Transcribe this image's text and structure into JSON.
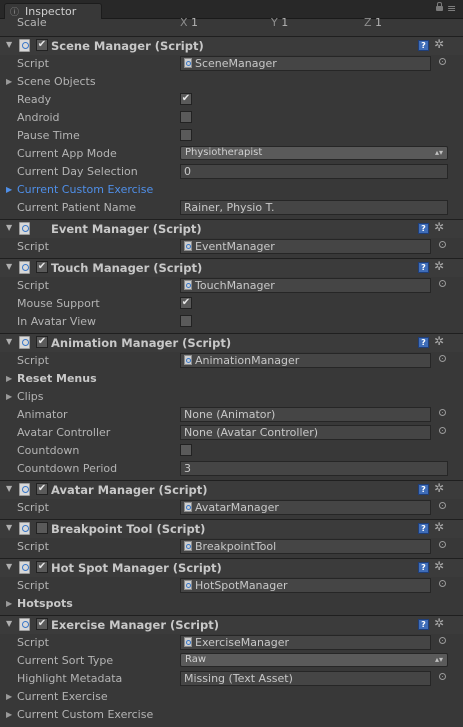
{
  "window": {
    "tab_label": "Inspector"
  },
  "scale": {
    "label": "Scale",
    "x": "1",
    "y": "1",
    "z": "1",
    "x_label": "X",
    "y_label": "Y",
    "z_label": "Z"
  },
  "components": {
    "scene": {
      "title": "Scene Manager (Script)",
      "script_label": "Script",
      "script_value": "SceneManager",
      "scene_objects": "Scene Objects",
      "ready_label": "Ready",
      "ready": true,
      "android_label": "Android",
      "android": false,
      "pause_label": "Pause Time",
      "pause": false,
      "app_mode_label": "Current App Mode",
      "app_mode": "Physiotherapist",
      "day_label": "Current Day Selection",
      "day": "0",
      "custom_ex_label": "Current Custom Exercise",
      "patient_label": "Current Patient Name",
      "patient": "Rainer, Physio T."
    },
    "event": {
      "title": "Event Manager (Script)",
      "script_label": "Script",
      "script_value": "EventManager"
    },
    "touch": {
      "title": "Touch Manager (Script)",
      "script_label": "Script",
      "script_value": "TouchManager",
      "mouse_label": "Mouse Support",
      "mouse": true,
      "avatar_view_label": "In Avatar View",
      "avatar_view": false
    },
    "animation": {
      "title": "Animation Manager (Script)",
      "script_label": "Script",
      "script_value": "AnimationManager",
      "reset_menus": "Reset Menus",
      "clips": "Clips",
      "animator_label": "Animator",
      "animator": "None (Animator)",
      "avatar_ctrl_label": "Avatar Controller",
      "avatar_ctrl": "None (Avatar Controller)",
      "countdown_label": "Countdown",
      "countdown": false,
      "period_label": "Countdown Period",
      "period": "3"
    },
    "avatar": {
      "title": "Avatar Manager (Script)",
      "script_label": "Script",
      "script_value": "AvatarManager"
    },
    "breakpoint": {
      "title": "Breakpoint Tool (Script)",
      "script_label": "Script",
      "script_value": "BreakpointTool"
    },
    "hotspot": {
      "title": "Hot Spot Manager (Script)",
      "script_label": "Script",
      "script_value": "HotSpotManager",
      "hotspots": "Hotspots"
    },
    "exercise": {
      "title": "Exercise Manager (Script)",
      "script_label": "Script",
      "script_value": "ExerciseManager",
      "sort_label": "Current Sort Type",
      "sort": "Raw",
      "highlight_label": "Highlight Metadata",
      "highlight": "Missing (Text Asset)",
      "current_ex": "Current Exercise",
      "current_custom_ex": "Current Custom Exercise"
    }
  },
  "icons": {
    "check": "✔",
    "fold_open": "▼",
    "fold_closed": "▶",
    "gear": "✲",
    "help": "?",
    "menu": "≡",
    "dropdown": "▴▾"
  },
  "colors": {
    "background": "#383838",
    "accent_blue": "#4f8fe8",
    "help_blue": "#3f6db8"
  }
}
